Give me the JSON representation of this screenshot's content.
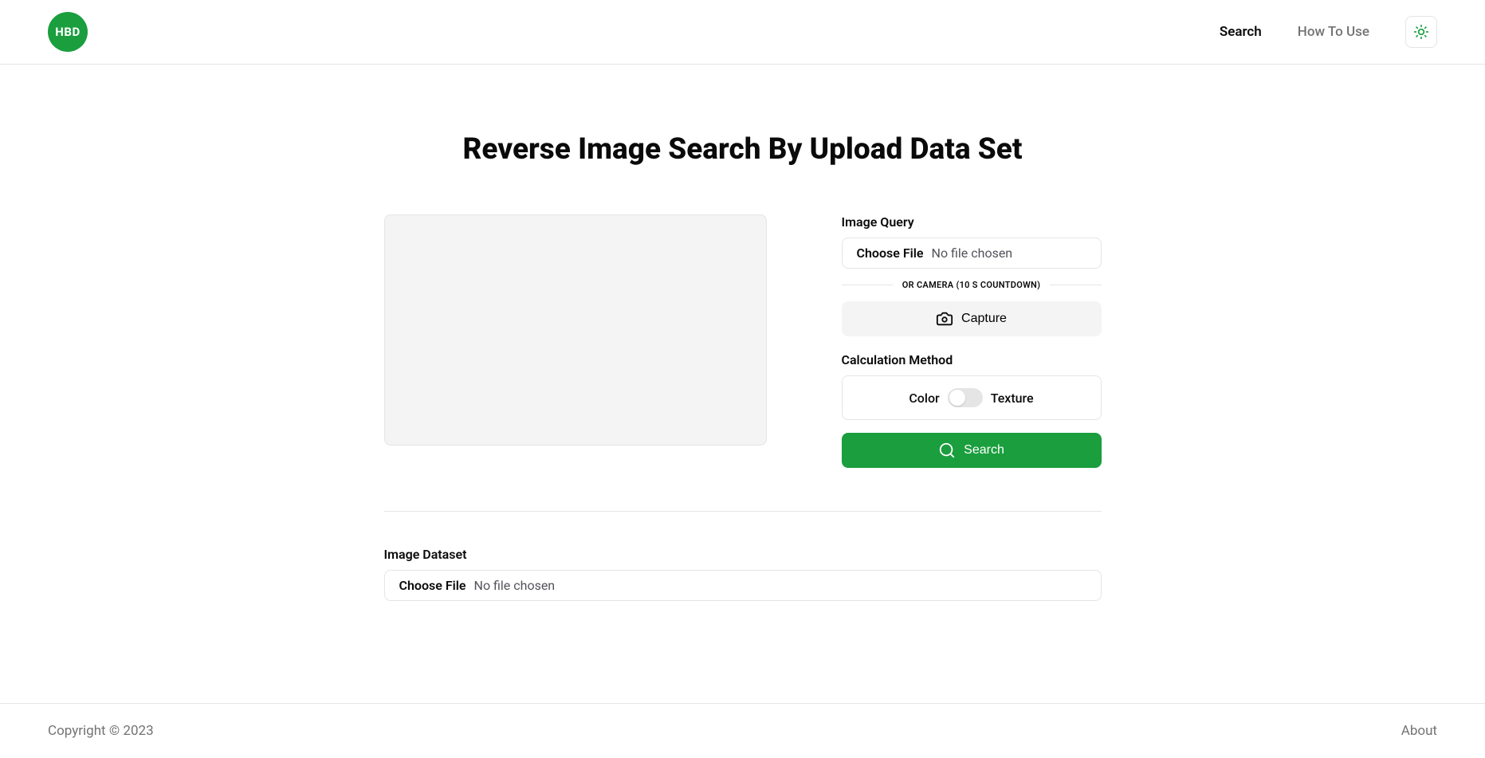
{
  "header": {
    "logo_text": "HBD",
    "nav": {
      "search": "Search",
      "how_to_use": "How To Use"
    }
  },
  "main": {
    "title": "Reverse Image Search By Upload Data Set",
    "image_query": {
      "label": "Image Query",
      "choose_file": "Choose File",
      "file_status": "No file chosen"
    },
    "camera": {
      "divider_text": "OR CAMERA (10 S COUNTDOWN)",
      "capture_label": "Capture"
    },
    "calculation": {
      "label": "Calculation Method",
      "option_a": "Color",
      "option_b": "Texture"
    },
    "search_button": "Search",
    "dataset": {
      "label": "Image Dataset",
      "choose_file": "Choose File",
      "file_status": "No file chosen"
    }
  },
  "footer": {
    "copyright": "Copyright © 2023",
    "about": "About"
  }
}
